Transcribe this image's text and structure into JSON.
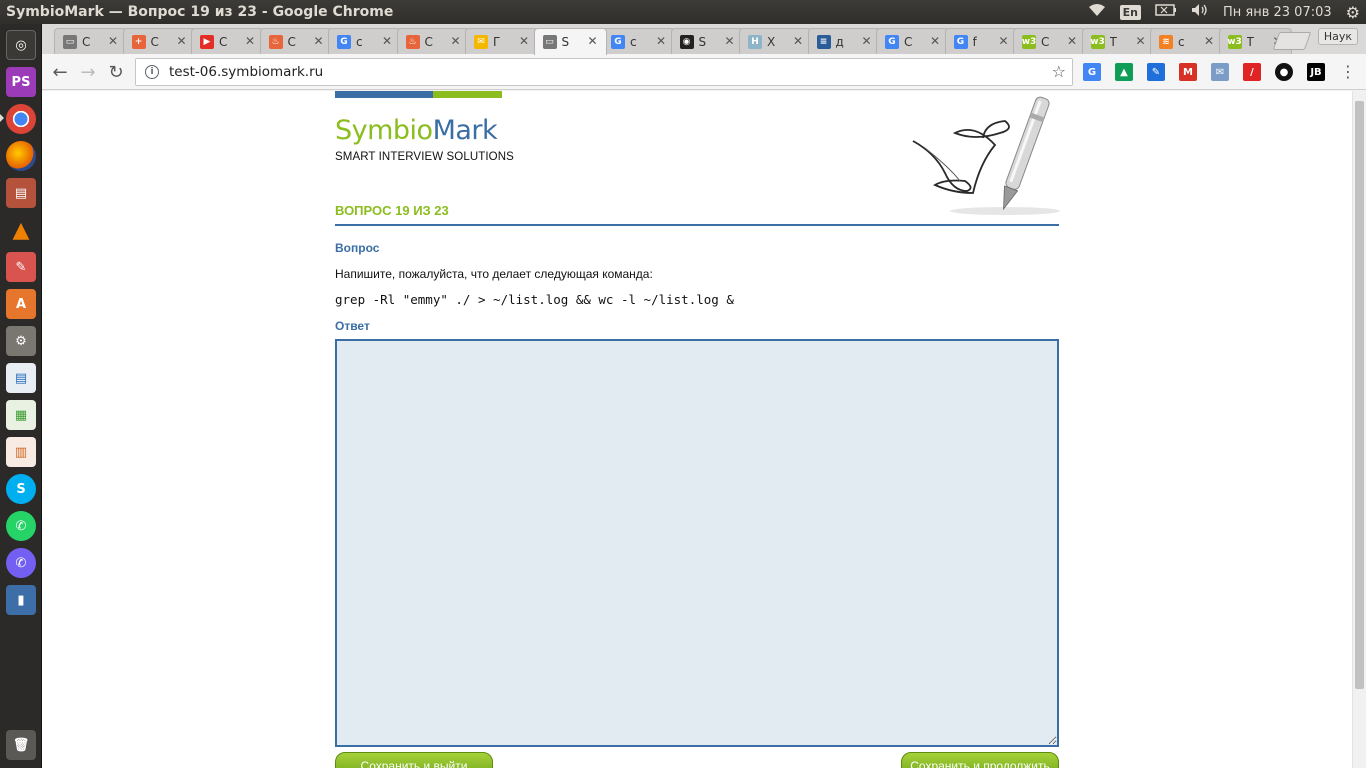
{
  "window": {
    "title": "SymbioMark — Вопрос 19 из 23 - Google Chrome"
  },
  "panel": {
    "lang": "En",
    "clock": "Пн янв 23 07:03"
  },
  "browser": {
    "tabs": [
      {
        "label": "C",
        "favicon": "page-icon",
        "color": "#777777"
      },
      {
        "label": "C",
        "favicon": "plus-icon",
        "color": "#e8643b"
      },
      {
        "label": "C",
        "favicon": "youtube-icon",
        "color": "#e52d27"
      },
      {
        "label": "C",
        "favicon": "flame-icon",
        "color": "#e8643b"
      },
      {
        "label": "c",
        "favicon": "google-icon",
        "color": "#4285f4"
      },
      {
        "label": "C",
        "favicon": "flame-icon",
        "color": "#e8643b"
      },
      {
        "label": "Г",
        "favicon": "mail-icon",
        "color": "#f5b800"
      },
      {
        "label": "S",
        "favicon": "page-icon",
        "color": "#777777",
        "active": true
      },
      {
        "label": "c",
        "favicon": "google-icon",
        "color": "#4285f4"
      },
      {
        "label": "S",
        "favicon": "github-icon",
        "color": "#222222"
      },
      {
        "label": "Х",
        "favicon": "h-icon",
        "color": "#8fb4c9"
      },
      {
        "label": "д",
        "favicon": "stack-icon",
        "color": "#2a5c9a"
      },
      {
        "label": "C",
        "favicon": "translate-icon",
        "color": "#4285f4"
      },
      {
        "label": "f",
        "favicon": "google-icon",
        "color": "#4285f4"
      },
      {
        "label": "C",
        "favicon": "w3-icon",
        "color": "#8bbd1f"
      },
      {
        "label": "T",
        "favicon": "w3-icon",
        "color": "#8bbd1f"
      },
      {
        "label": "c",
        "favicon": "stackoverflow-icon",
        "color": "#f48024"
      },
      {
        "label": "T",
        "favicon": "w3-icon",
        "color": "#8bbd1f"
      }
    ],
    "profile": "Наук",
    "url": "test-06.symbiomark.ru"
  },
  "page": {
    "logo_part1": "Symbio",
    "logo_part2": "Mark",
    "tagline": "SMART INTERVIEW SOLUTIONS",
    "question_header": "ВОПРОС 19 ИЗ 23",
    "question_label": "Вопрос",
    "question_text": "Напишите, пожалуйста, что делает следующая команда:",
    "command": "grep -Rl \"emmy\" ./ > ~/list.log && wc -l ~/list.log &",
    "answer_label": "Ответ",
    "answer_value": "",
    "save_exit_label": "Сохранить и выйти",
    "save_continue_label": "Сохранить и продолжить"
  },
  "colors": {
    "brand_blue": "#3b6ea5",
    "brand_green": "#8bbd1f",
    "answer_bg": "#e2ebf1"
  }
}
